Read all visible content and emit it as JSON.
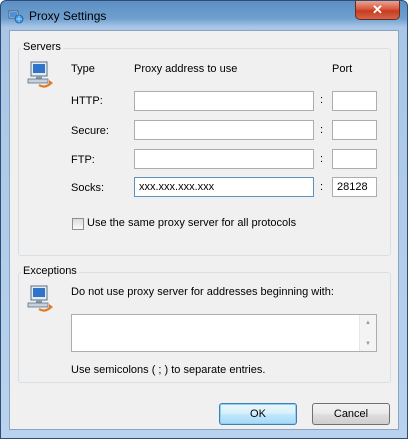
{
  "window": {
    "title": "Proxy Settings",
    "close_label": "✕"
  },
  "servers": {
    "group_label": "Servers",
    "headers": {
      "type": "Type",
      "address": "Proxy address to use",
      "port": "Port"
    },
    "rows": [
      {
        "label": "HTTP:",
        "address": "",
        "port": ""
      },
      {
        "label": "Secure:",
        "address": "",
        "port": ""
      },
      {
        "label": "FTP:",
        "address": "",
        "port": ""
      },
      {
        "label": "Socks:",
        "address": "xxx.xxx.xxx.xxx",
        "port": "28128"
      }
    ],
    "separator": ":",
    "same_proxy_label": "Use the same proxy server for all protocols",
    "same_proxy_checked": false
  },
  "exceptions": {
    "group_label": "Exceptions",
    "description": "Do not use proxy server for addresses beginning with:",
    "value": "",
    "hint": "Use semicolons ( ; ) to separate entries."
  },
  "buttons": {
    "ok": "OK",
    "cancel": "Cancel"
  },
  "icons": {
    "title": "network-globe-icon",
    "servers": "network-computer-icon",
    "exceptions": "network-computer-icon"
  }
}
